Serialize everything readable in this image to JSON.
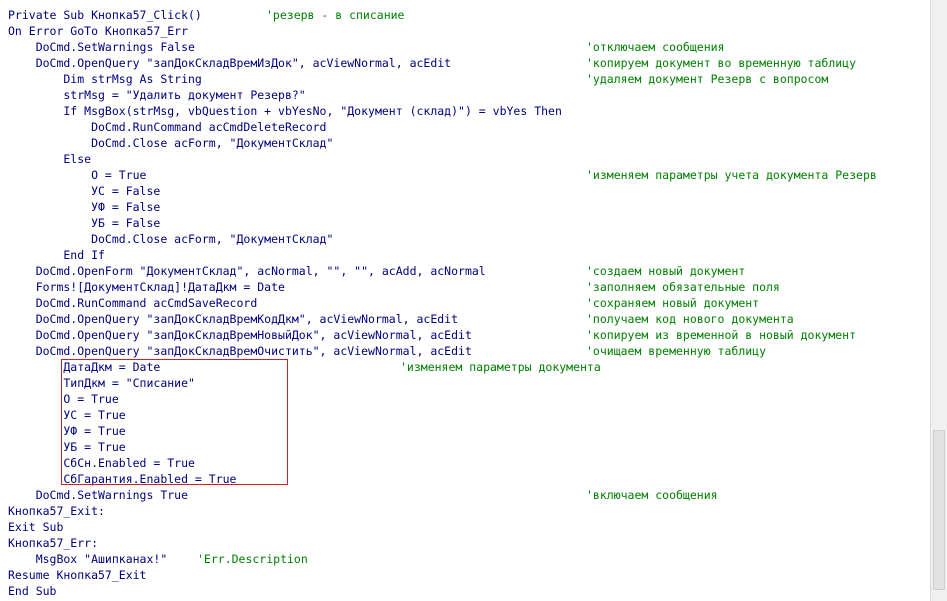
{
  "code_lines": [
    {
      "code": "Private Sub Кнопка57_Click()",
      "comment": "'резерв - в списание"
    },
    {
      "code": "On Error GoTo Кнопка57_Err",
      "comment": ""
    },
    {
      "code": "    DoCmd.SetWarnings False",
      "comment": "'отключаем сообщения"
    },
    {
      "code": "    DoCmd.OpenQuery \"запДокСкладВремИзДок\", acViewNormal, acEdit",
      "comment": "'копируем документ во временную таблицу"
    },
    {
      "code": "        Dim strMsg As String",
      "comment": "'удаляем документ Резерв с вопросом"
    },
    {
      "code": "        strMsg = \"Удалить документ Резерв?\"",
      "comment": ""
    },
    {
      "code": "        If MsgBox(strMsg, vbQuestion + vbYesNo, \"Документ (склад)\") = vbYes Then",
      "comment": ""
    },
    {
      "code": "            DoCmd.RunCommand acCmdDeleteRecord",
      "comment": ""
    },
    {
      "code": "            DoCmd.Close acForm, \"ДокументСклад\"",
      "comment": ""
    },
    {
      "code": "        Else",
      "comment": ""
    },
    {
      "code": "            О = True",
      "comment": "'изменяем параметры учета документа Резерв"
    },
    {
      "code": "            УС = False",
      "comment": ""
    },
    {
      "code": "            УФ = False",
      "comment": ""
    },
    {
      "code": "            УБ = False",
      "comment": ""
    },
    {
      "code": "            DoCmd.Close acForm, \"ДокументСклад\"",
      "comment": ""
    },
    {
      "code": "        End If",
      "comment": ""
    },
    {
      "code": "    DoCmd.OpenForm \"ДокументСклад\", acNormal, \"\", \"\", acAdd, acNormal",
      "comment": "'создаем новый документ"
    },
    {
      "code": "    Forms![ДокументСклад]!ДатаДкм = Date",
      "comment": "'заполняем обязательные поля"
    },
    {
      "code": "    DoCmd.RunCommand acCmdSaveRecord",
      "comment": "'сохраняем новый документ"
    },
    {
      "code": "    DoCmd.OpenQuery \"запДокСкладВремКодДкм\", acViewNormal, acEdit",
      "comment": "'получаем код нового документа"
    },
    {
      "code": "    DoCmd.OpenQuery \"запДокСкладВремНовыйДок\", acViewNormal, acEdit",
      "comment": "'копируем из временной в новый документ"
    },
    {
      "code": "    DoCmd.OpenQuery \"запДокСкладВремОчистить\", acViewNormal, acEdit",
      "comment": "'очищаем временную таблицу"
    },
    {
      "code": "        ДатаДкм = Date",
      "comment": "'изменяем параметры документа"
    },
    {
      "code": "        ТипДкм = \"Списание\"",
      "comment": ""
    },
    {
      "code": "        О = True",
      "comment": ""
    },
    {
      "code": "        УС = True",
      "comment": ""
    },
    {
      "code": "        УФ = True",
      "comment": ""
    },
    {
      "code": "        УБ = True",
      "comment": ""
    },
    {
      "code": "        СбСн.Enabled = True",
      "comment": ""
    },
    {
      "code": "        СбГарантия.Enabled = True",
      "comment": ""
    },
    {
      "code": "    DoCmd.SetWarnings True",
      "comment": "'включаем сообщения"
    },
    {
      "code": "Кнопка57_Exit:",
      "comment": ""
    },
    {
      "code": "Exit Sub",
      "comment": ""
    },
    {
      "code": "Кнопка57_Err:",
      "comment": ""
    },
    {
      "code": "    MsgBox \"Ашипканах!\"",
      "comment": "'Err.Description"
    },
    {
      "code": "Resume Кнопка57_Exit",
      "comment": ""
    },
    {
      "code": "End Sub",
      "comment": ""
    }
  ],
  "colors": {
    "code": "#000080",
    "comment": "#008000",
    "highlight_border": "#d22020"
  }
}
